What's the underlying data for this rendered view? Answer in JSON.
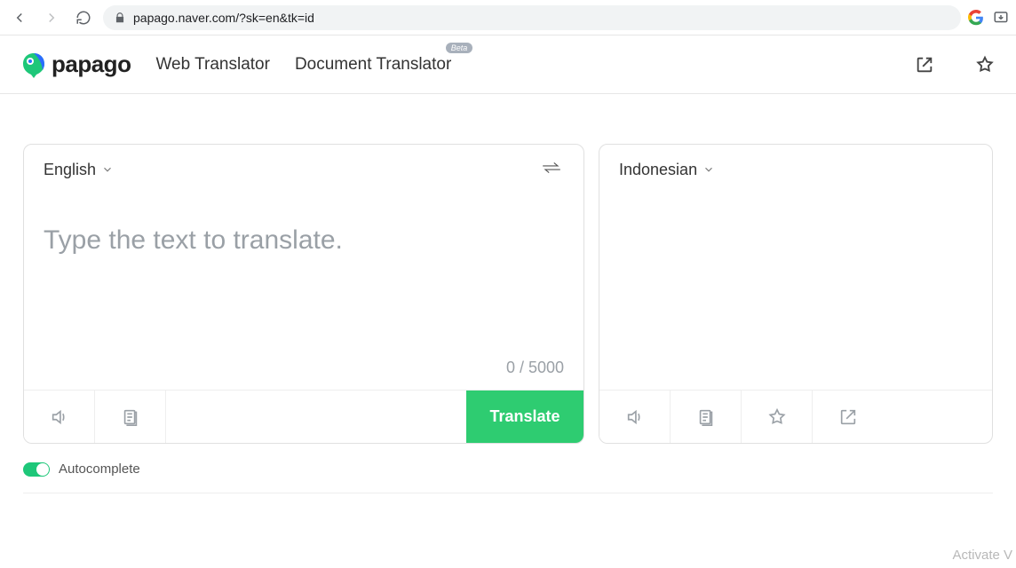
{
  "browser": {
    "url": "papago.naver.com/?sk=en&tk=id"
  },
  "header": {
    "brand": "papago",
    "nav": {
      "web": "Web Translator",
      "doc": "Document Translator",
      "doc_badge": "Beta"
    }
  },
  "source": {
    "lang": "English",
    "placeholder": "Type the text to translate.",
    "count": "0 / 5000",
    "translate": "Translate"
  },
  "target": {
    "lang": "Indonesian"
  },
  "auto": {
    "label": "Autocomplete"
  },
  "watermark": "Activate V"
}
